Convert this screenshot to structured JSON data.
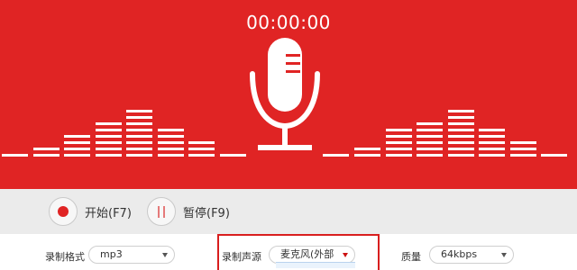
{
  "recorder": {
    "timer": "00:00:00"
  },
  "controls": {
    "start_label": "开始(F7)",
    "pause_label": "暂停(F9)"
  },
  "settings": {
    "format": {
      "label": "录制格式",
      "value": "mp3"
    },
    "source": {
      "label": "录制声源",
      "value": "麦克风(外部"
    },
    "quality": {
      "label": "质量",
      "value": "64kbps"
    }
  },
  "level_meter": {
    "left_levels": [
      1,
      2,
      4,
      6,
      8,
      5,
      3,
      1
    ],
    "right_levels": [
      1,
      2,
      5,
      6,
      8,
      5,
      3,
      1
    ]
  },
  "colors": {
    "accent": "#e02424",
    "meter_segment": "#ffffff",
    "controls_bg": "#ebebeb",
    "highlight_border": "#d81e1e"
  },
  "icons": {
    "microphone": "microphone-icon",
    "record": "record-icon",
    "pause": "pause-icon",
    "dropdown": "chevron-down-icon"
  }
}
